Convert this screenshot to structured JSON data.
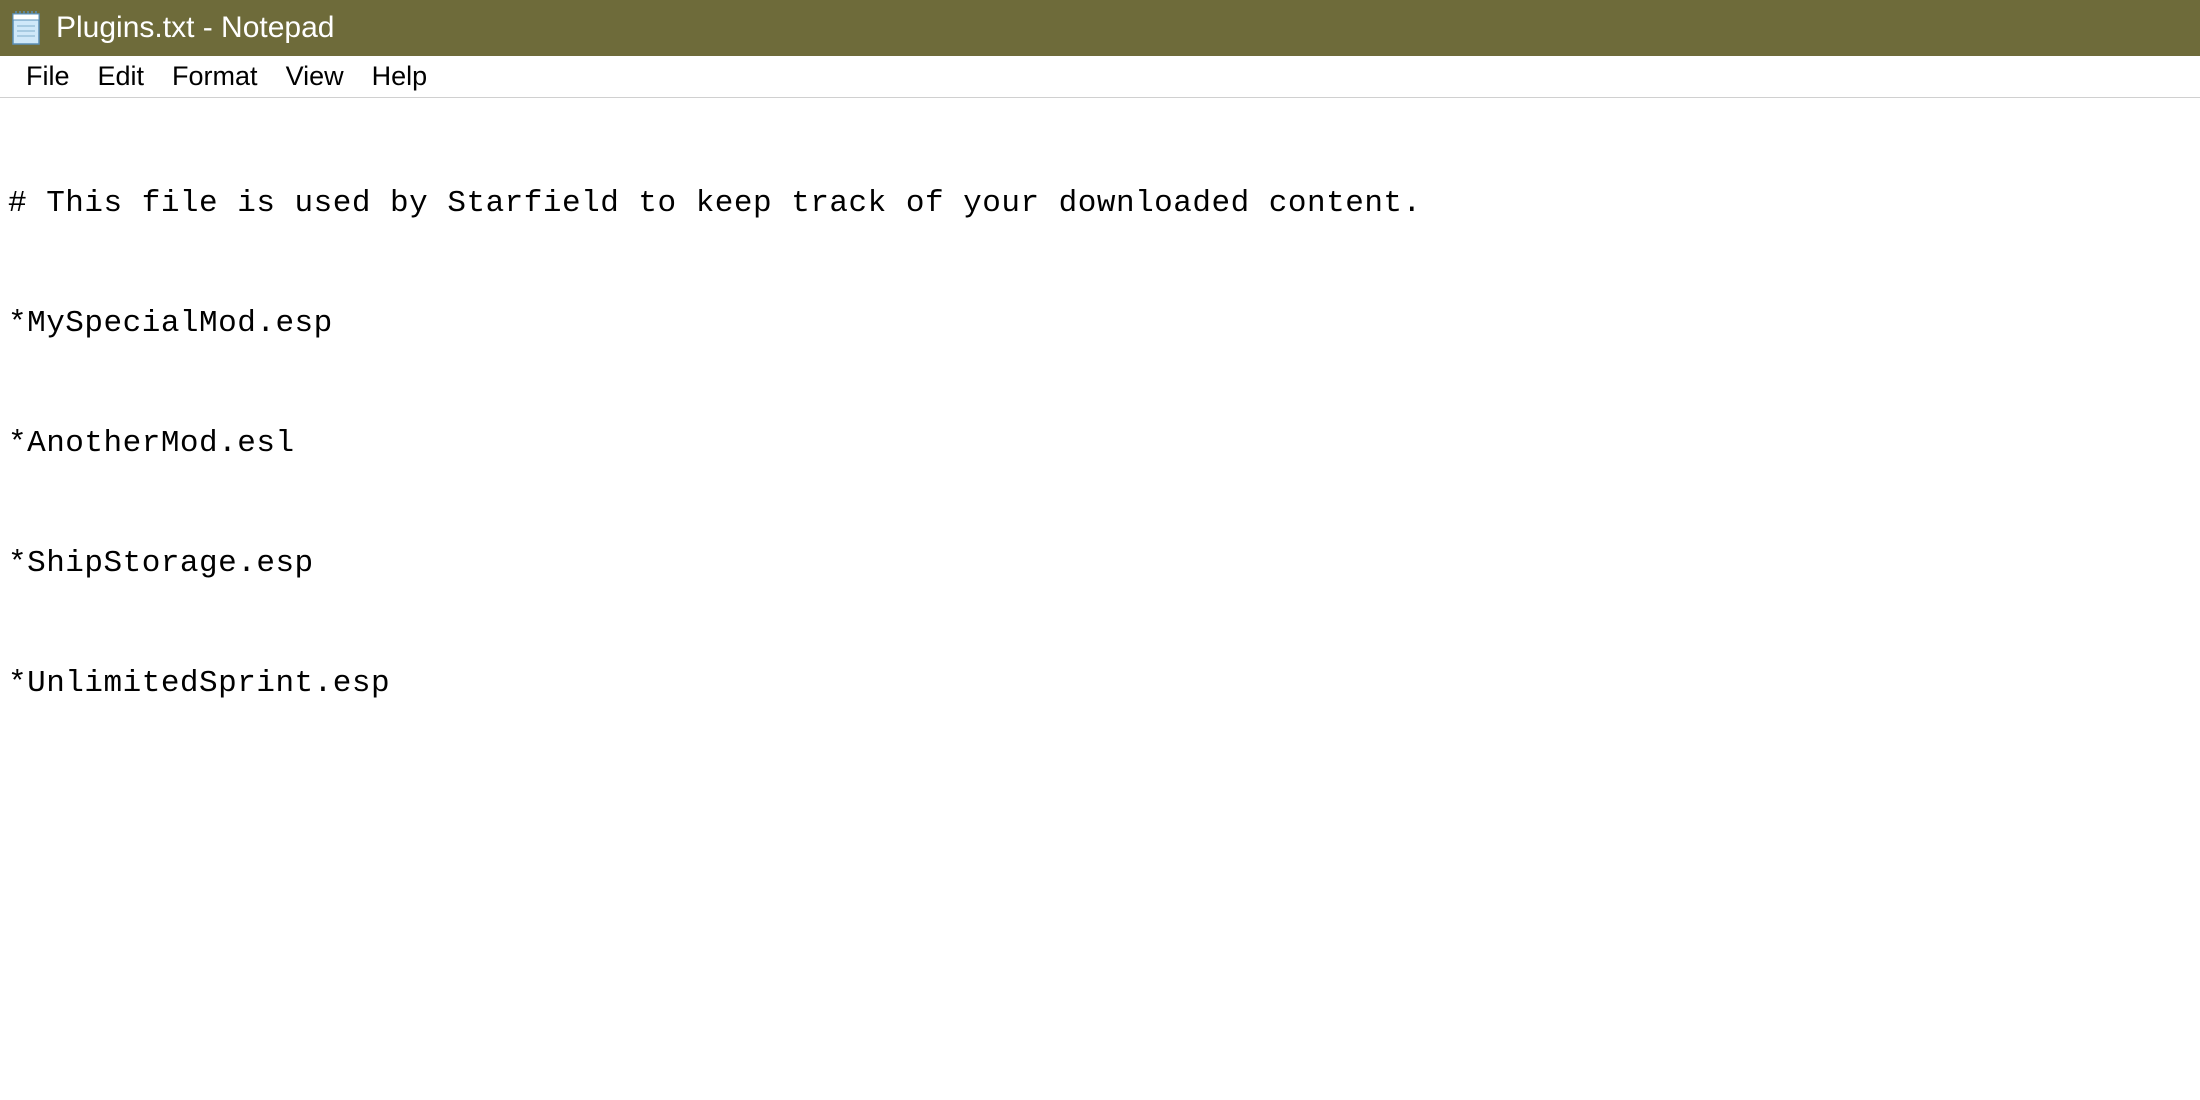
{
  "titlebar": {
    "title": "Plugins.txt - Notepad"
  },
  "menubar": {
    "items": [
      {
        "label": "File"
      },
      {
        "label": "Edit"
      },
      {
        "label": "Format"
      },
      {
        "label": "View"
      },
      {
        "label": "Help"
      }
    ]
  },
  "editor": {
    "lines": [
      "# This file is used by Starfield to keep track of your downloaded content.",
      "*MySpecialMod.esp",
      "*AnotherMod.esl",
      "*ShipStorage.esp",
      "*UnlimitedSprint.esp"
    ]
  }
}
